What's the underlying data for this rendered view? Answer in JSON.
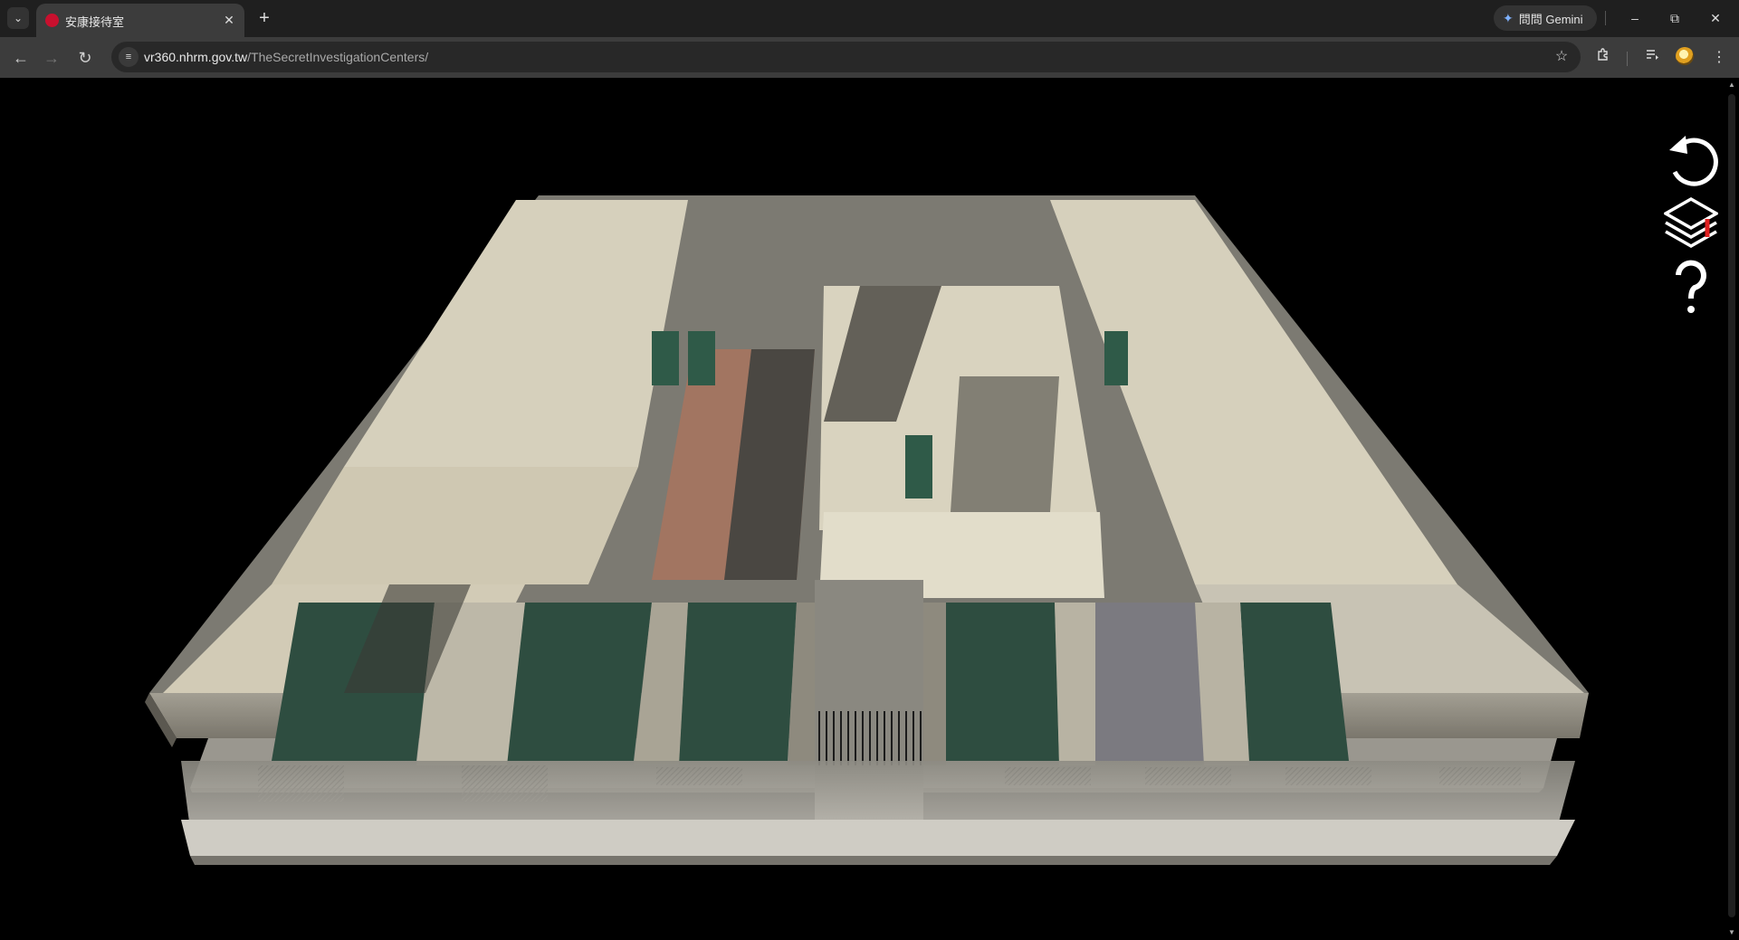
{
  "browser": {
    "tab": {
      "title": "安康接待室"
    },
    "url": {
      "host": "vr360.nhrm.gov.tw",
      "path": "/TheSecretInvestigationCenters/"
    },
    "gemini_label": "問問 Gemini"
  },
  "icons": {
    "tab_search": "chevron-down-icon",
    "tab_close": "close-icon",
    "new_tab": "plus-icon",
    "back": "arrow-left-icon",
    "forward": "arrow-right-icon",
    "reload": "reload-icon",
    "site_info": "tune-icon",
    "bookmark": "star-icon",
    "extensions": "puzzle-icon",
    "media": "playlist-icon",
    "menu": "kebab-icon",
    "reset_view": "rotate-left-icon",
    "floors": "layers-icon",
    "help": "question-mark-icon"
  },
  "colors": {
    "tab_strip": "#1f1f1f",
    "toolbar": "#3c3c3c",
    "floor_marker": "#e02020"
  }
}
